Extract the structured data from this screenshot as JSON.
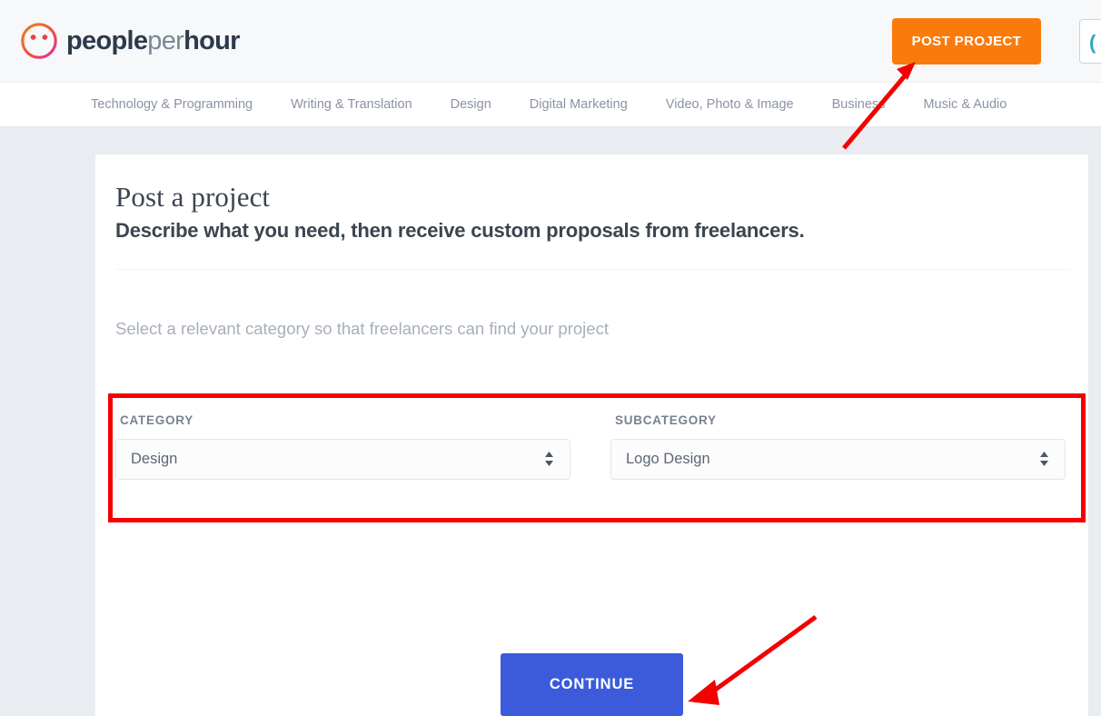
{
  "header": {
    "logo": {
      "icon": "peopleperhour-smiley-logo-icon",
      "text_bold_1": "people",
      "text_light": "per",
      "text_bold_2": "hour",
      "color_start": "#f07c2a",
      "color_end": "#e3288e"
    },
    "post_project_label": "POST PROJECT",
    "post_project_color": "#fa7b0c",
    "partial_button_glyph": "("
  },
  "nav": {
    "items": [
      {
        "label": "Technology & Programming"
      },
      {
        "label": "Writing & Translation"
      },
      {
        "label": "Design"
      },
      {
        "label": "Digital Marketing"
      },
      {
        "label": "Video, Photo & Image"
      },
      {
        "label": "Business"
      },
      {
        "label": "Music & Audio"
      }
    ]
  },
  "main": {
    "title": "Post a project",
    "subtitle": "Describe what you need, then receive custom proposals from freelancers.",
    "helper_text": "Select a relevant category so that freelancers can find your project",
    "fields": {
      "category": {
        "label": "CATEGORY",
        "value": "Design"
      },
      "subcategory": {
        "label": "SUBCATEGORY",
        "value": "Logo Design"
      }
    },
    "continue_label": "CONTINUE",
    "continue_color": "#3b5bdb"
  },
  "annotations": {
    "highlight_color": "#f40000",
    "arrow_color": "#f40000",
    "arrow_to_post_project": "arrow pointing up-right to POST PROJECT button",
    "arrow_to_continue": "arrow pointing down-left to CONTINUE button"
  }
}
